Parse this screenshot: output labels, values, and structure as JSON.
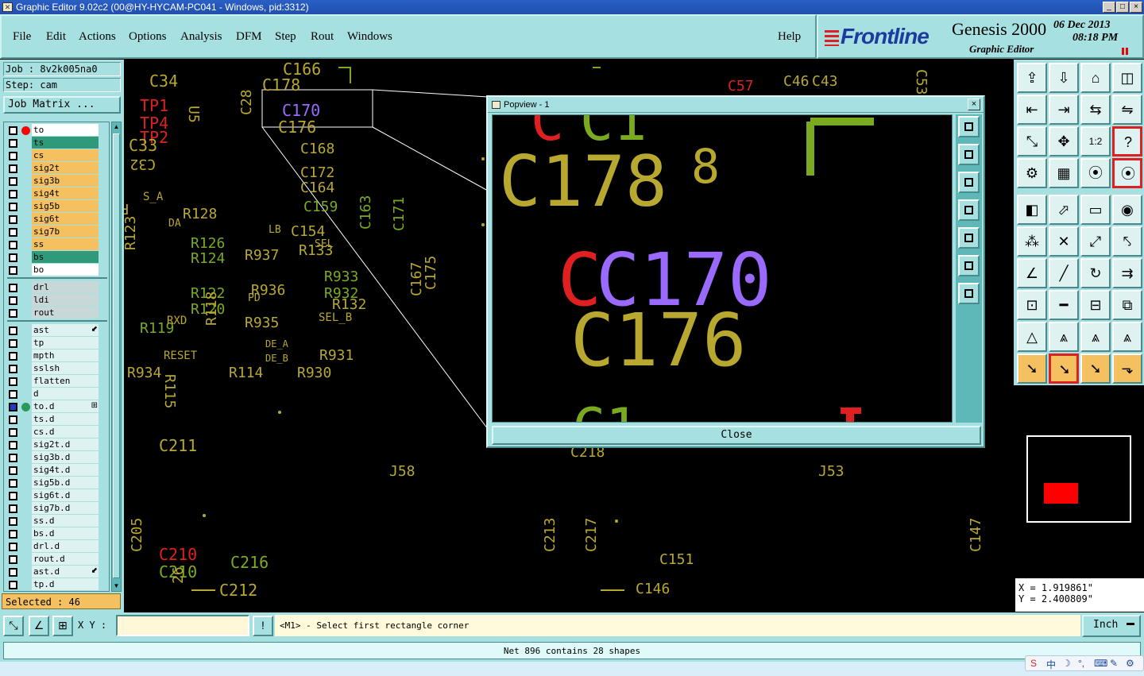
{
  "titlebar": {
    "title": "Graphic Editor 9.02c2 (00@HY-HYCAM-PC041 - Windows, pid:3312)",
    "min": "_",
    "max": "□",
    "close": "×"
  },
  "menu": [
    "File",
    "Edit",
    "Actions",
    "Options",
    "Analysis",
    "DFM",
    "Step",
    "Rout",
    "Windows"
  ],
  "help": "Help",
  "brand": {
    "logo": "Frontline",
    "product": "Genesis 2000",
    "subtitle": "Graphic Editor",
    "date": "06  Dec  2013",
    "time": "08:18  PM"
  },
  "job": {
    "job_label": "Job : 8v2k005na0",
    "step_label": "Step: cam",
    "matrix_button": "Job Matrix ..."
  },
  "layers": {
    "group1": [
      {
        "name": "to",
        "color": "#ffffff",
        "dot": "#ff0000"
      },
      {
        "name": "ts",
        "color": "#2e9a7a"
      },
      {
        "name": "cs",
        "color": "#f4c060"
      },
      {
        "name": "sig2t",
        "color": "#f4c060"
      },
      {
        "name": "sig3b",
        "color": "#f4c060"
      },
      {
        "name": "sig4t",
        "color": "#f4c060"
      },
      {
        "name": "sig5b",
        "color": "#f4c060"
      },
      {
        "name": "sig6t",
        "color": "#f4c060"
      },
      {
        "name": "sig7b",
        "color": "#f4c060"
      },
      {
        "name": "ss",
        "color": "#f4c060"
      },
      {
        "name": "bs",
        "color": "#2e9a7a"
      },
      {
        "name": "bo",
        "color": "#ffffff"
      }
    ],
    "group2": [
      {
        "name": "drl",
        "color": "#c8d8d8"
      },
      {
        "name": "ldi",
        "color": "#c8d8d8"
      },
      {
        "name": "rout",
        "color": "#c8d8d8"
      }
    ],
    "group3": [
      {
        "name": "ast",
        "mark": "⬋"
      },
      {
        "name": "tp"
      },
      {
        "name": "mpth"
      },
      {
        "name": "sslsh"
      },
      {
        "name": "flatten"
      },
      {
        "name": "d"
      },
      {
        "name": "to.d",
        "active": true,
        "mark": "⊞"
      },
      {
        "name": "ts.d"
      },
      {
        "name": "cs.d"
      },
      {
        "name": "sig2t.d"
      },
      {
        "name": "sig3b.d"
      },
      {
        "name": "sig4t.d"
      },
      {
        "name": "sig5b.d"
      },
      {
        "name": "sig6t.d"
      },
      {
        "name": "sig7b.d"
      },
      {
        "name": "ss.d"
      },
      {
        "name": "bs.d"
      },
      {
        "name": "drl.d"
      },
      {
        "name": "rout.d"
      },
      {
        "name": "ast.d",
        "mark": "⬋"
      },
      {
        "name": "tp.d"
      }
    ]
  },
  "selected": "Selected : 46",
  "pcb_labels": [
    {
      "t": "C34",
      "c": "#b8a830"
    },
    {
      "t": "TP1",
      "c": "#e02020"
    },
    {
      "t": "TP4",
      "c": "#e02020"
    },
    {
      "t": "TP2",
      "c": "#e02020"
    },
    {
      "t": "C33",
      "c": "#b8a830"
    },
    {
      "t": "U5",
      "c": "#b8a830"
    },
    {
      "t": "C28",
      "c": "#b8a830"
    },
    {
      "t": "C166",
      "c": "#b8a830"
    },
    {
      "t": "C178",
      "c": "#b8a830"
    },
    {
      "t": "C170",
      "c": "#9a6aff"
    },
    {
      "t": "C176",
      "c": "#b8a830"
    },
    {
      "t": "C168",
      "c": "#b8a830"
    },
    {
      "t": "C172",
      "c": "#b8a830"
    },
    {
      "t": "C164",
      "c": "#b8a830"
    },
    {
      "t": "C159",
      "c": "#7aaa20"
    },
    {
      "t": "C154",
      "c": "#b8a830"
    },
    {
      "t": "C32",
      "c": "#b8a830"
    },
    {
      "t": "R1",
      "c": "#b8a830"
    },
    {
      "t": "R128",
      "c": "#b8a830"
    },
    {
      "t": "R126",
      "c": "#7aaa20"
    },
    {
      "t": "R124",
      "c": "#7aaa20"
    },
    {
      "t": "R937",
      "c": "#b8a830"
    },
    {
      "t": "R133",
      "c": "#b8a830"
    },
    {
      "t": "R123",
      "c": "#b8a830"
    },
    {
      "t": "R936",
      "c": "#b8a830"
    },
    {
      "t": "R933",
      "c": "#7aaa20"
    },
    {
      "t": "R932",
      "c": "#7aaa20"
    },
    {
      "t": "R132",
      "c": "#b8a830"
    },
    {
      "t": "R122",
      "c": "#7aaa20"
    },
    {
      "t": "R120",
      "c": "#7aaa20"
    },
    {
      "t": "R935",
      "c": "#b8a830"
    },
    {
      "t": "R119",
      "c": "#7aaa20"
    },
    {
      "t": "R118",
      "c": "#b8a830"
    },
    {
      "t": "R931",
      "c": "#b8a830"
    },
    {
      "t": "R934",
      "c": "#b8a830"
    },
    {
      "t": "R114",
      "c": "#b8a830"
    },
    {
      "t": "R930",
      "c": "#b8a830"
    },
    {
      "t": "R115",
      "c": "#b8a830"
    },
    {
      "t": "C163",
      "c": "#7aaa20"
    },
    {
      "t": "C171",
      "c": "#7aaa20"
    },
    {
      "t": "C167",
      "c": "#b8a830"
    },
    {
      "t": "C175",
      "c": "#b8a830"
    },
    {
      "t": "C211",
      "c": "#b8a830"
    },
    {
      "t": "J58",
      "c": "#b8a830"
    },
    {
      "t": "C218",
      "c": "#b8a830"
    },
    {
      "t": "J53",
      "c": "#b8a830"
    },
    {
      "t": "C205",
      "c": "#b8a830"
    },
    {
      "t": "C210",
      "c": "#e02020"
    },
    {
      "t": "C210",
      "c": "#7aaa20"
    },
    {
      "t": "C216",
      "c": "#7aaa20"
    },
    {
      "t": "C212",
      "c": "#b8a830"
    },
    {
      "t": "C213",
      "c": "#b8a830"
    },
    {
      "t": "C217",
      "c": "#b8a830"
    },
    {
      "t": "C146",
      "c": "#b8a830"
    },
    {
      "t": "C151",
      "c": "#b8a830"
    },
    {
      "t": "C147",
      "c": "#b8a830"
    },
    {
      "t": "C57",
      "c": "#e02020"
    },
    {
      "t": "C46",
      "c": "#b8a830"
    },
    {
      "t": "C43",
      "c": "#b8a830"
    },
    {
      "t": "C53",
      "c": "#b8a830"
    },
    {
      "t": "SEL_B",
      "c": "#b8a830"
    },
    {
      "t": "RESET",
      "c": "#b8a830"
    },
    {
      "t": "RXD",
      "c": "#b8a830"
    },
    {
      "t": "DE_A",
      "c": "#b8a830"
    },
    {
      "t": "DE_B",
      "c": "#b8a830"
    },
    {
      "t": "S_A",
      "c": "#b8a830"
    },
    {
      "t": "LB",
      "c": "#b8a830"
    },
    {
      "t": "SEL",
      "c": "#b8a830"
    },
    {
      "t": "PD",
      "c": "#b8a830"
    },
    {
      "t": "DA",
      "c": "#b8a830"
    },
    {
      "t": "26",
      "c": "#b8a830"
    }
  ],
  "popview": {
    "title": "Popview - 1",
    "close_x": "×",
    "close_button": "Close",
    "labels": [
      "C178",
      "C170",
      "C176"
    ]
  },
  "overview_coords": {
    "x": "X = 1.919861\"",
    "y": "Y = 2.400809\""
  },
  "status": {
    "xy_label": "X Y :",
    "xy_value": "",
    "prompt": "<M1> - Select first rectangle corner",
    "units": "Inch",
    "net_info": "Net 896 contains 28 shapes"
  },
  "right_tools": [
    "⇪",
    "⇩",
    "⌂",
    "◫",
    "⇤",
    "⇥",
    "⇆",
    "⇋",
    "⤡",
    "✥",
    "1:2",
    "?",
    "⚙",
    "▦",
    "⦿",
    "⦿",
    "◧",
    "⬀",
    "▭",
    "◉",
    "⁂",
    "✕",
    "⤢",
    "⤣",
    "∠",
    "╱",
    "↻",
    "⇉",
    "⊡",
    "━",
    "⊟",
    "⧉",
    "△",
    "⩓",
    "⩓",
    "⩓",
    "➘",
    "➘",
    "➘",
    "⬎"
  ],
  "ime": [
    "S",
    "中",
    "☽",
    "°,",
    "⌨",
    "✎",
    "⚙"
  ]
}
